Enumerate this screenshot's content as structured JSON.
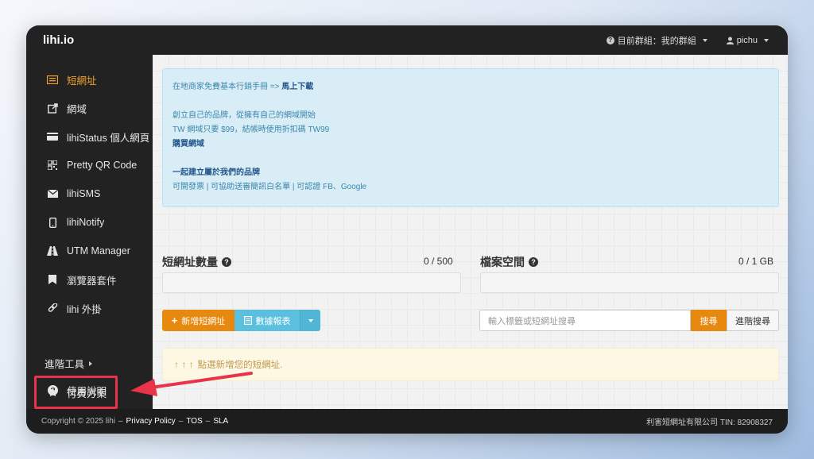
{
  "brand": "lihi.io",
  "topbar": {
    "group_label": "目前群組：我的群組",
    "user_label": "pichu"
  },
  "sidebar": {
    "items": [
      {
        "label": "短網址",
        "icon": "list-icon"
      },
      {
        "label": "網域",
        "icon": "external-link-icon"
      },
      {
        "label": "lihiStatus 個人網頁",
        "icon": "id-card-icon"
      },
      {
        "label": "Pretty QR Code",
        "icon": "qrcode-icon"
      },
      {
        "label": "lihiSMS",
        "icon": "envelope-icon"
      },
      {
        "label": "lihiNotify",
        "icon": "mobile-icon"
      },
      {
        "label": "UTM Manager",
        "icon": "road-icon"
      },
      {
        "label": "瀏覽器套件",
        "icon": "bookmark-icon"
      },
      {
        "label": "lihi 外掛",
        "icon": "link-icon"
      }
    ],
    "advanced_tools": "進階工具",
    "help": "使用說明",
    "pricing": "付費方案"
  },
  "info": {
    "line1_prefix": "在地商家免費基本行銷手冊 =>",
    "line1_link": "馬上下載",
    "line2": "創立自己的品牌，從擁有自己的網域開始",
    "line3": "TW 網域只要 $99，結帳時使用折扣碼 TW99",
    "line4_link": "購買網域",
    "line5_link": "一起建立屬於我們的品牌",
    "line6": "可開發票 | 可協助送審簡訊白名單 | 可認證 FB、Google"
  },
  "stats": {
    "urls_title": "短網址數量",
    "urls_value": "0 / 500",
    "storage_title": "檔案空間",
    "storage_value": "0 / 1 GB"
  },
  "actions": {
    "new_url": "新增短網址",
    "report": "數據報表",
    "search_placeholder": "輸入標籤或短網址搜尋",
    "search": "搜尋",
    "advanced_search": "進階搜尋"
  },
  "warning": {
    "arrows": "↑ ↑ ↑",
    "text": "點選新增您的短網址."
  },
  "footer": {
    "copyright": "Copyright © 2025 lihi",
    "privacy": "Privacy Policy",
    "tos": "TOS",
    "sla": "SLA",
    "sep": "–",
    "company": "利害短網址有限公司 TIN: 82908327"
  },
  "colors": {
    "accent": "#f0a02b",
    "orange_button": "#e8890f",
    "blue_button": "#5bc0de",
    "highlight": "#e8334a"
  }
}
